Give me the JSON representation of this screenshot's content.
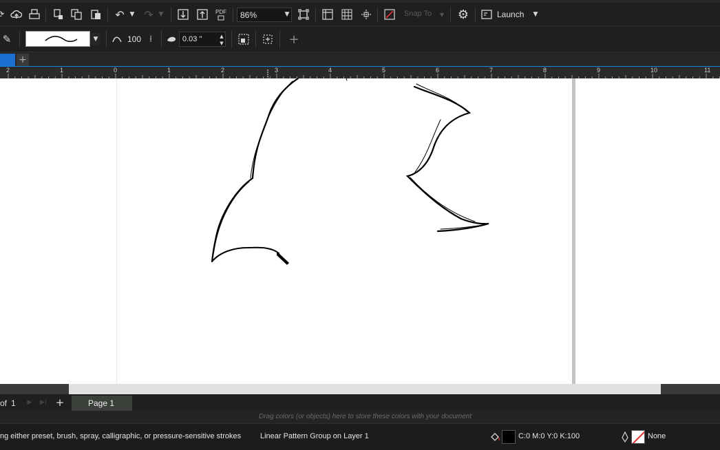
{
  "toolbar": {
    "zoom_value": "86%",
    "snap_to_label": "Snap To",
    "launch_label": "Launch",
    "pdf_label": "PDF"
  },
  "property_bar": {
    "smoothing_value": "100",
    "stroke_width_value": "0.03 \""
  },
  "ruler": {
    "labels": [
      "2",
      "1",
      "0",
      "1",
      "2",
      "3",
      "4",
      "5",
      "6",
      "7",
      "8",
      "9",
      "10",
      "11"
    ]
  },
  "page_nav": {
    "of_label": "of",
    "page_count": "1",
    "page_tab_label": "Page 1"
  },
  "palette": {
    "hint": "Drag colors (or objects) here to store these colors with your document"
  },
  "status": {
    "tool_hint": "ng either preset, brush, spray, calligraphic, or pressure-sensitive strokes",
    "selection_info": "Linear Pattern Group on Layer 1",
    "fill_value": "C:0 M:0 Y:0 K:100",
    "outline_value": "None"
  },
  "colors": {
    "accent": "#1a86d6",
    "fill_swatch": "#000000",
    "outline_none_slash": "#e03030"
  }
}
